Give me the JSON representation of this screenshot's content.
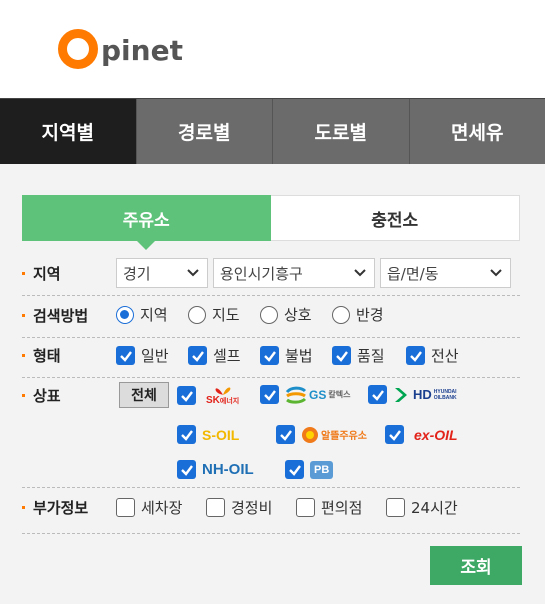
{
  "logo": {
    "initial": "O",
    "rest": "pinet"
  },
  "tabs": [
    {
      "label": "지역별",
      "active": true
    },
    {
      "label": "경로별",
      "active": false
    },
    {
      "label": "도로별",
      "active": false
    },
    {
      "label": "면세유",
      "active": false
    }
  ],
  "subtabs": [
    {
      "label": "주유소",
      "active": true
    },
    {
      "label": "충전소",
      "active": false
    }
  ],
  "region": {
    "label": "지역",
    "selects": [
      {
        "value": "경기"
      },
      {
        "value": "용인시기흥구"
      },
      {
        "value": "읍/면/동"
      }
    ]
  },
  "search_method": {
    "label": "검색방법",
    "options": [
      {
        "label": "지역",
        "selected": true
      },
      {
        "label": "지도",
        "selected": false
      },
      {
        "label": "상호",
        "selected": false
      },
      {
        "label": "반경",
        "selected": false
      }
    ]
  },
  "type": {
    "label": "형태",
    "options": [
      {
        "label": "일반",
        "checked": true
      },
      {
        "label": "셀프",
        "checked": true
      },
      {
        "label": "불법",
        "checked": true
      },
      {
        "label": "품질",
        "checked": true
      },
      {
        "label": "전산",
        "checked": true
      }
    ]
  },
  "brand": {
    "label": "상표",
    "all_label": "전체",
    "brands": [
      {
        "name": "SK에너지",
        "logo_main": "SK",
        "logo_sub": "에너지",
        "checked": true,
        "color": "#e2231a"
      },
      {
        "name": "GS칼텍스",
        "logo_main": "GS",
        "logo_sub": "칼텍스",
        "checked": true,
        "color": "#1f8fc9"
      },
      {
        "name": "HD현대오일뱅크",
        "logo_main": "HD",
        "logo_sub": "HYUNDAI OILBANK",
        "checked": true,
        "color": "#1b3f8f"
      },
      {
        "name": "S-OIL",
        "logo_main": "S-OIL",
        "checked": true,
        "color": "#f2b800"
      },
      {
        "name": "알뜰주유소",
        "logo_main": "알뜰주유소",
        "checked": true,
        "color": "#f07a1a"
      },
      {
        "name": "ex-OIL",
        "logo_main": "ex-OIL",
        "checked": true,
        "color": "#e2231a"
      },
      {
        "name": "NH-OIL",
        "logo_main": "NH-OIL",
        "checked": true,
        "color": "#1f6fb5"
      },
      {
        "name": "PB",
        "logo_main": "PB",
        "checked": true,
        "color": "#5b9bd5"
      }
    ]
  },
  "extra": {
    "label": "부가정보",
    "options": [
      {
        "label": "세차장",
        "checked": false
      },
      {
        "label": "경정비",
        "checked": false
      },
      {
        "label": "편의점",
        "checked": false
      },
      {
        "label": "24시간",
        "checked": false
      }
    ]
  },
  "submit_label": "조회",
  "colors": {
    "accent_green": "#5fc27a",
    "submit_green": "#3ea865",
    "check_blue": "#1a6ed8",
    "brand_orange": "#ff7a00"
  }
}
